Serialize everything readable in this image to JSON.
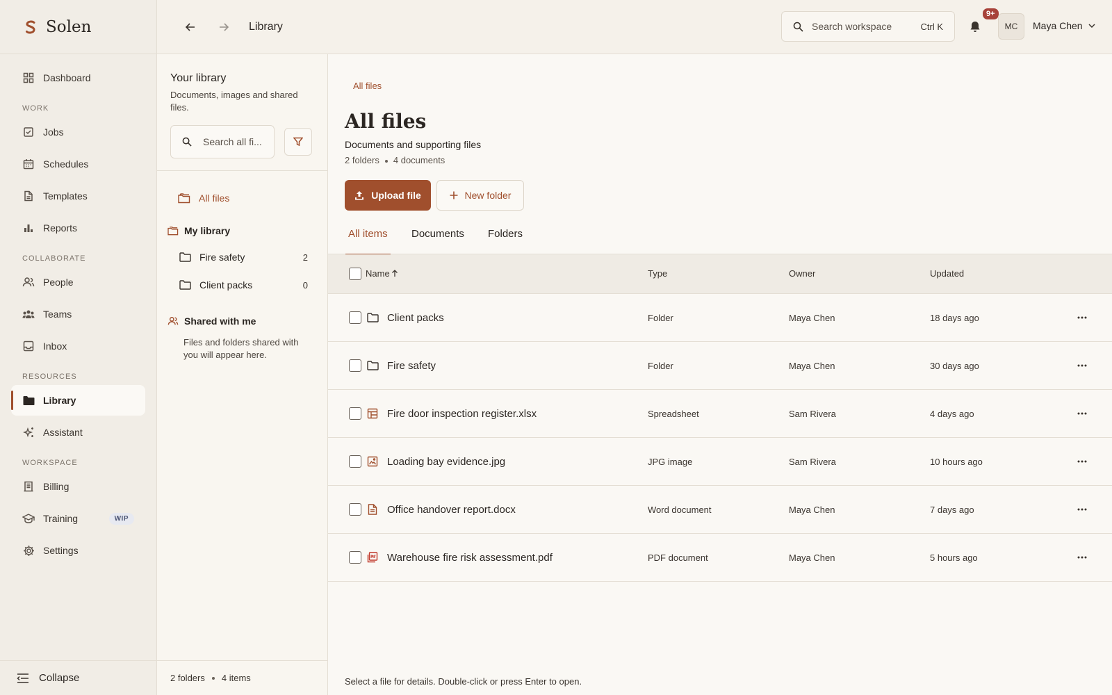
{
  "brand": {
    "name": "Solen"
  },
  "sidebar": {
    "top_items": [
      {
        "label": "Dashboard",
        "icon": "grid-icon"
      }
    ],
    "sections": [
      {
        "title": "WORK",
        "items": [
          {
            "label": "Jobs",
            "icon": "clipboard-check-icon"
          },
          {
            "label": "Schedules",
            "icon": "calendar-icon"
          },
          {
            "label": "Templates",
            "icon": "file-icon"
          },
          {
            "label": "Reports",
            "icon": "bar-chart-icon"
          }
        ]
      },
      {
        "title": "COLLABORATE",
        "items": [
          {
            "label": "People",
            "icon": "users-icon"
          },
          {
            "label": "Teams",
            "icon": "team-icon"
          },
          {
            "label": "Inbox",
            "icon": "inbox-icon"
          }
        ]
      },
      {
        "title": "RESOURCES",
        "items": [
          {
            "label": "Library",
            "icon": "folder-filled-icon",
            "active": true
          },
          {
            "label": "Assistant",
            "icon": "sparkle-icon"
          }
        ]
      },
      {
        "title": "WORKSPACE",
        "items": [
          {
            "label": "Billing",
            "icon": "receipt-icon"
          },
          {
            "label": "Training",
            "icon": "graduation-cap-icon",
            "badge": "WIP"
          },
          {
            "label": "Settings",
            "icon": "gear-icon"
          }
        ]
      }
    ],
    "collapse_label": "Collapse"
  },
  "topbar": {
    "title": "Library",
    "search_placeholder": "Search workspace",
    "search_shortcut": "Ctrl K",
    "notification_count": "9+",
    "avatar_initials": "MC",
    "user_name": "Maya Chen"
  },
  "library_panel": {
    "title": "Your library",
    "subtitle": "Documents, images and shared files.",
    "search_placeholder": "Search all fi...",
    "all_files_label": "All files",
    "my_library_label": "My library",
    "folders": [
      {
        "name": "Fire safety",
        "count": "2"
      },
      {
        "name": "Client packs",
        "count": "0"
      }
    ],
    "shared_label": "Shared with me",
    "shared_note": "Files and folders shared with you will appear here.",
    "footer_folders": "2 folders",
    "footer_items": "4 items"
  },
  "main": {
    "breadcrumb": "All files",
    "title": "All files",
    "subtitle": "Documents and supporting files",
    "meta_folders": "2 folders",
    "meta_documents": "4 documents",
    "upload_label": "Upload file",
    "new_folder_label": "New folder",
    "tabs": [
      "All items",
      "Documents",
      "Folders"
    ],
    "columns": {
      "name": "Name",
      "type": "Type",
      "owner": "Owner",
      "updated": "Updated"
    },
    "rows": [
      {
        "name": "Client packs",
        "type": "Folder",
        "owner": "Maya Chen",
        "updated": "18 days ago",
        "icon": "folder-icon"
      },
      {
        "name": "Fire safety",
        "type": "Folder",
        "owner": "Maya Chen",
        "updated": "30 days ago",
        "icon": "folder-icon"
      },
      {
        "name": "Fire door inspection register.xlsx",
        "type": "Spreadsheet",
        "owner": "Sam Rivera",
        "updated": "4 days ago",
        "icon": "spreadsheet-icon"
      },
      {
        "name": "Loading bay evidence.jpg",
        "type": "JPG image",
        "owner": "Sam Rivera",
        "updated": "10 hours ago",
        "icon": "image-icon"
      },
      {
        "name": "Office handover report.docx",
        "type": "Word document",
        "owner": "Maya Chen",
        "updated": "7 days ago",
        "icon": "document-icon"
      },
      {
        "name": "Warehouse fire risk assessment.pdf",
        "type": "PDF document",
        "owner": "Maya Chen",
        "updated": "5 hours ago",
        "icon": "pdf-icon"
      }
    ],
    "footer_hint": "Select a file for details. Double-click or press Enter to open."
  },
  "colors": {
    "accent": "#a04f2d",
    "badge": "#a7423a",
    "sidebar_bg": "#f1ede6"
  }
}
